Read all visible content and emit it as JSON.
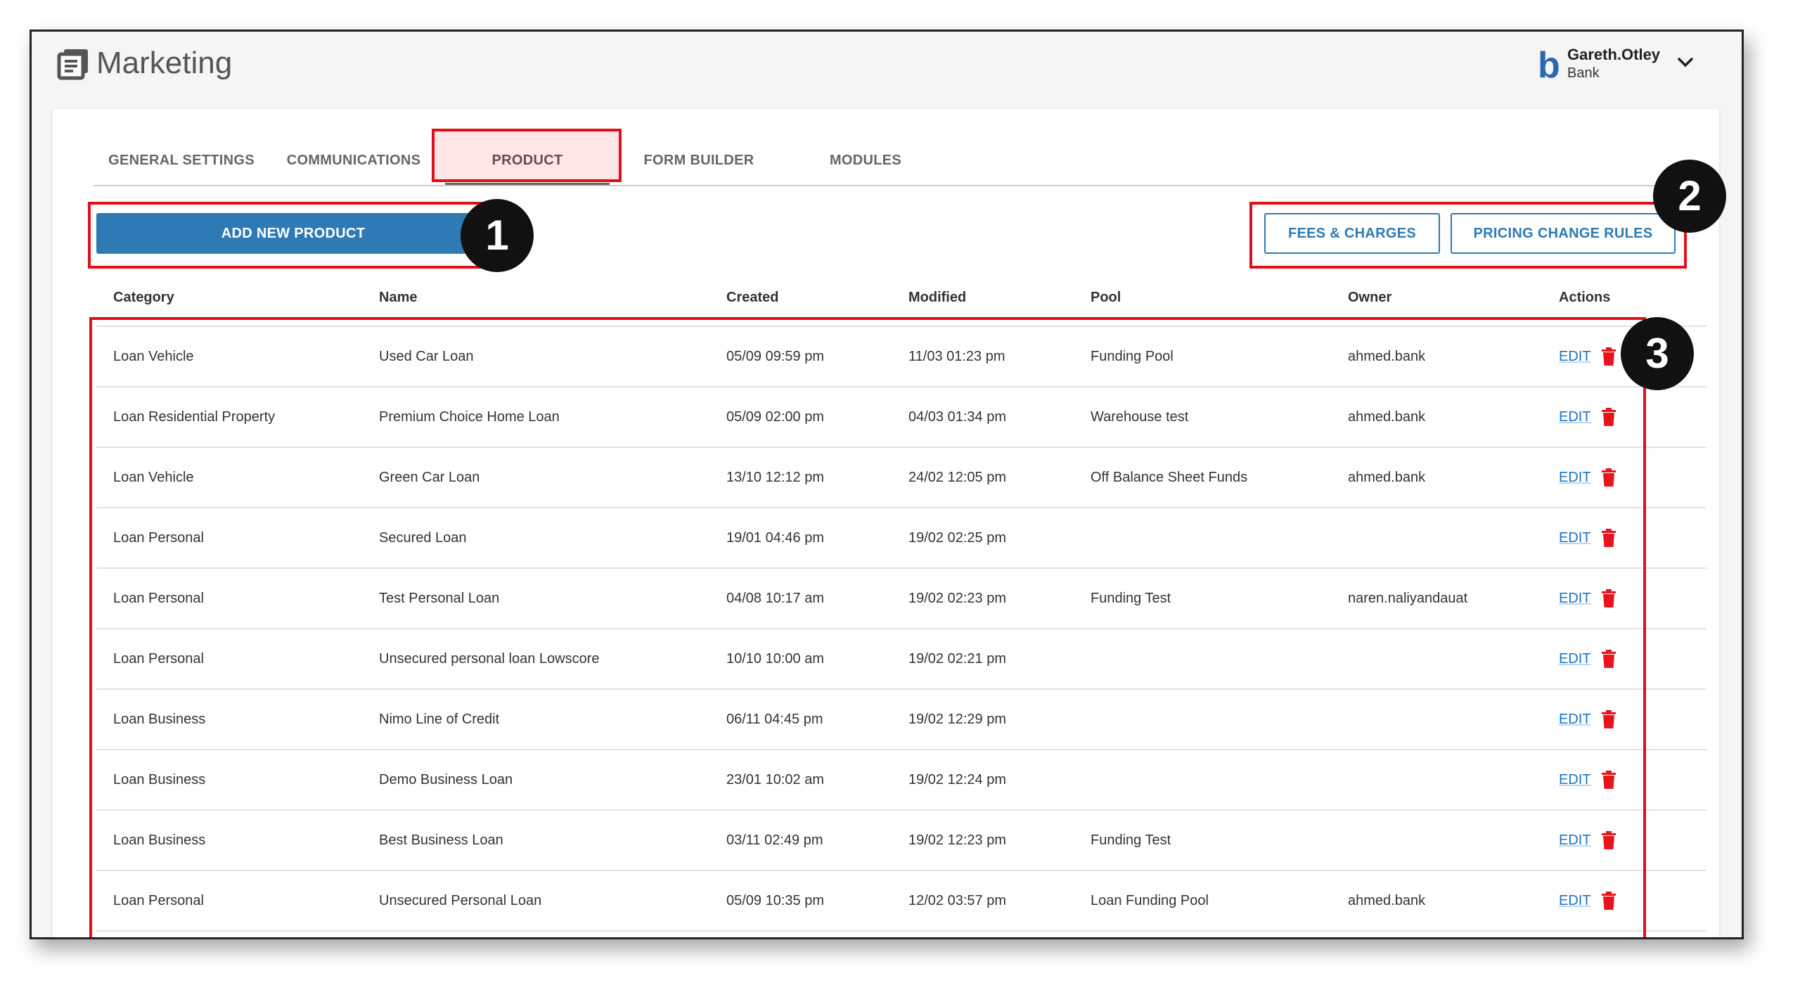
{
  "app": {
    "title": "Marketing",
    "icon": "document-list-icon"
  },
  "user": {
    "logo": "b",
    "name": "Gareth.Otley",
    "org": "Bank"
  },
  "tabs": [
    {
      "label": "GENERAL SETTINGS"
    },
    {
      "label": "COMMUNICATIONS"
    },
    {
      "label": "PRODUCT",
      "active": true
    },
    {
      "label": "FORM BUILDER"
    },
    {
      "label": "MODULES"
    }
  ],
  "toolbar": {
    "add_label": "ADD NEW PRODUCT",
    "fees_label": "FEES & CHARGES",
    "pricing_label": "PRICING CHANGE RULES"
  },
  "callouts": [
    "1",
    "2",
    "3"
  ],
  "table": {
    "headers": [
      "Category",
      "Name",
      "Created",
      "Modified",
      "Pool",
      "Owner",
      "Actions"
    ],
    "edit_label": "EDIT",
    "rows": [
      {
        "category": "Loan Vehicle",
        "name": "Used Car Loan",
        "created": "05/09 09:59 pm",
        "modified": "11/03 01:23 pm",
        "pool": "Funding Pool",
        "owner": "ahmed.bank"
      },
      {
        "category": "Loan Residential Property",
        "name": "Premium Choice Home Loan",
        "created": "05/09 02:00 pm",
        "modified": "04/03 01:34 pm",
        "pool": "Warehouse test",
        "owner": "ahmed.bank"
      },
      {
        "category": "Loan Vehicle",
        "name": "Green Car Loan",
        "created": "13/10 12:12 pm",
        "modified": "24/02 12:05 pm",
        "pool": "Off Balance Sheet Funds",
        "owner": "ahmed.bank"
      },
      {
        "category": "Loan Personal",
        "name": "Secured Loan",
        "created": "19/01 04:46 pm",
        "modified": "19/02 02:25 pm",
        "pool": "",
        "owner": ""
      },
      {
        "category": "Loan Personal",
        "name": "Test Personal Loan",
        "created": "04/08 10:17 am",
        "modified": "19/02 02:23 pm",
        "pool": "Funding Test",
        "owner": "naren.naliyandauat"
      },
      {
        "category": "Loan Personal",
        "name": "Unsecured personal loan Lowscore",
        "created": "10/10 10:00 am",
        "modified": "19/02 02:21 pm",
        "pool": "",
        "owner": ""
      },
      {
        "category": "Loan Business",
        "name": "Nimo Line of Credit",
        "created": "06/11 04:45 pm",
        "modified": "19/02 12:29 pm",
        "pool": "",
        "owner": ""
      },
      {
        "category": "Loan Business",
        "name": "Demo Business Loan",
        "created": "23/01 10:02 am",
        "modified": "19/02 12:24 pm",
        "pool": "",
        "owner": ""
      },
      {
        "category": "Loan Business",
        "name": "Best Business Loan",
        "created": "03/11 02:49 pm",
        "modified": "19/02 12:23 pm",
        "pool": "Funding Test",
        "owner": ""
      },
      {
        "category": "Loan Personal",
        "name": "Unsecured Personal Loan",
        "created": "05/09 10:35 pm",
        "modified": "12/02 03:57 pm",
        "pool": "Loan Funding Pool",
        "owner": "ahmed.bank"
      }
    ]
  },
  "colors": {
    "accent": "#2d7ab5",
    "highlight": "#e0101a",
    "delete": "#e8141c",
    "link": "#1a73c9"
  }
}
